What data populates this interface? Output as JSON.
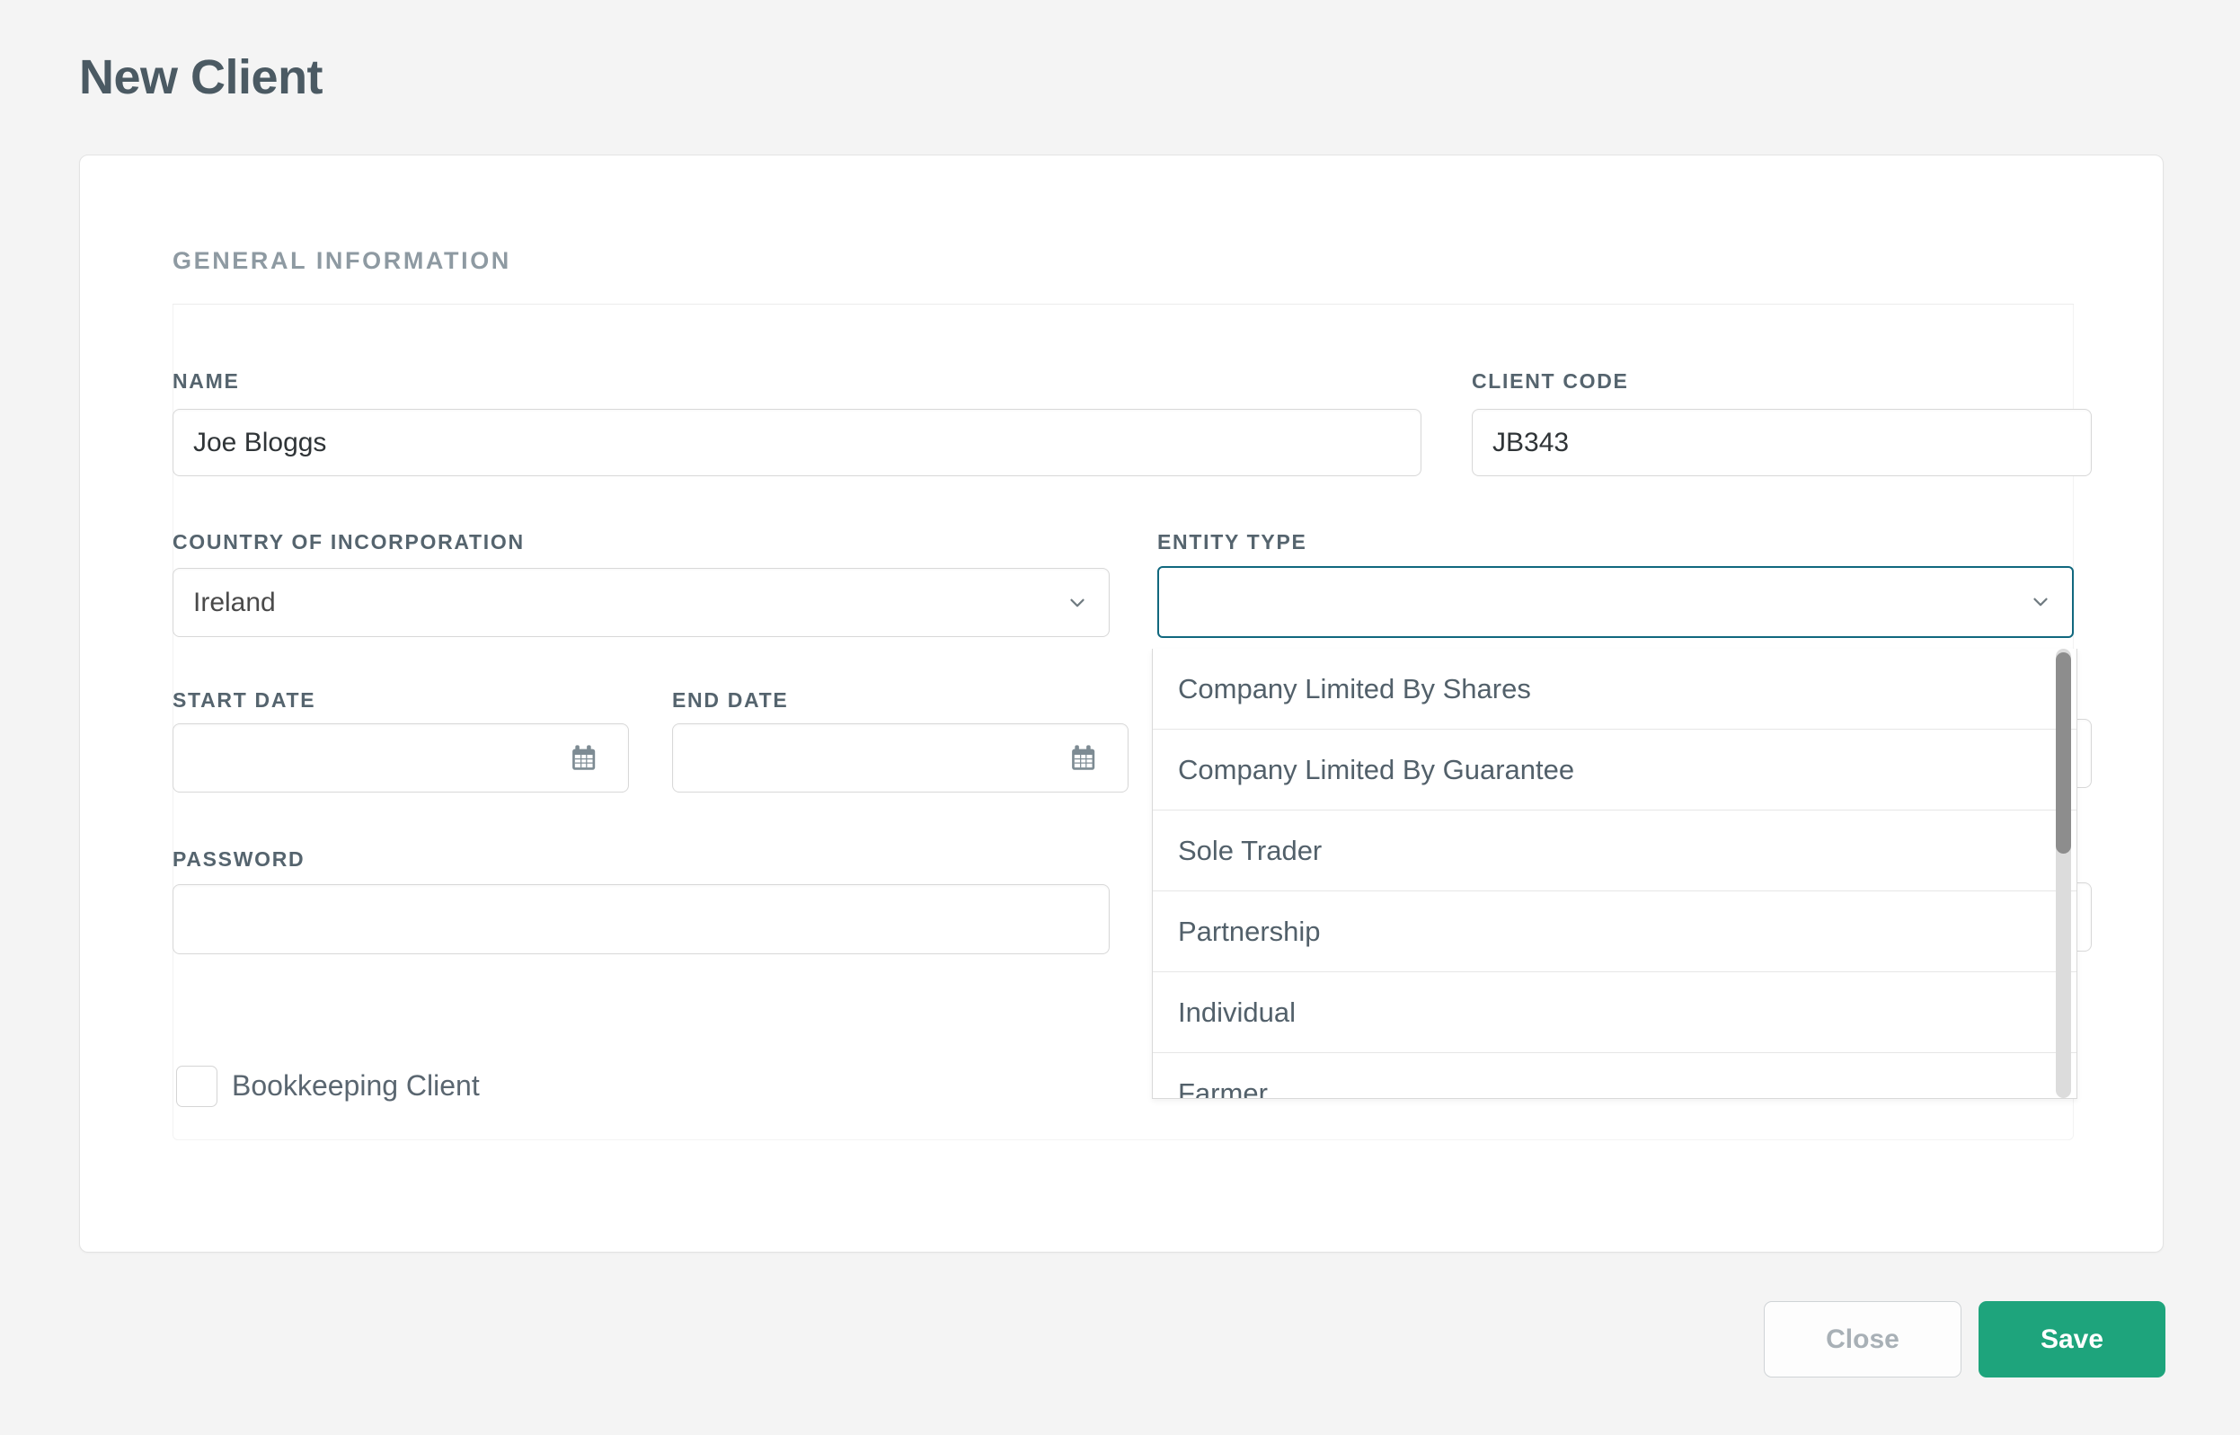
{
  "page": {
    "title": "New Client",
    "background_color": "#f4f4f4"
  },
  "section": {
    "heading": "GENERAL INFORMATION"
  },
  "form": {
    "name": {
      "label": "NAME",
      "value": "Joe Bloggs",
      "placeholder": ""
    },
    "client_code": {
      "label": "CLIENT CODE",
      "value": "JB343",
      "placeholder": ""
    },
    "country_of_incorporation": {
      "label": "COUNTRY OF INCORPORATION",
      "value": "Ireland",
      "chevron": "chevron-down-icon"
    },
    "entity_type": {
      "label": "ENTITY TYPE",
      "value": "",
      "placeholder": "",
      "chevron": "chevron-down-icon",
      "expanded": true,
      "focus_border_color": "#11687e",
      "options": [
        "Company Limited By Shares",
        "Company Limited By Guarantee",
        "Sole Trader",
        "Partnership",
        "Individual",
        "Farmer"
      ]
    },
    "start_date": {
      "label": "START DATE",
      "value": "",
      "placeholder": "",
      "icon": "calendar-icon"
    },
    "end_date": {
      "label": "END DATE",
      "value": "",
      "placeholder": "",
      "icon": "calendar-icon"
    },
    "password": {
      "label": "PASSWORD",
      "value": "",
      "placeholder": ""
    },
    "bookkeeping_client": {
      "label": "Bookkeeping Client",
      "checked": false
    }
  },
  "footer": {
    "close_label": "Close",
    "save_label": "Save",
    "save_color": "#1ea47c"
  }
}
